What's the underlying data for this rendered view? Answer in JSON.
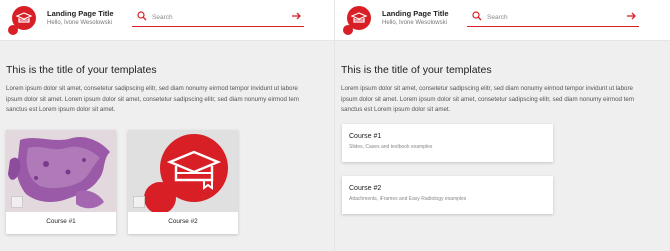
{
  "colors": {
    "accent": "#d81f26"
  },
  "header": {
    "title": "Landing Page Title",
    "subtitle": "Hello, Ivone Wesolowski",
    "search_placeholder": "Search",
    "logo_icon": "red-blob-graduation-cap-logo",
    "search_icon": "search-icon",
    "submit_icon": "arrow-right-icon"
  },
  "main": {
    "title": "This is the title of your templates",
    "intro_lines": [
      "Lorem ipsum dolor sit amet, consetetur sadipscing elitr, sed diam nonumy eirmod tempor invidunt ut labore",
      "ipsum dolor sit amet. Lorem ipsum dolor sit amet, consetetur sadipscing elitr, sed diam nonumy eirmod tem",
      "sanctus est Lorem ipsum dolor sit amet."
    ]
  },
  "tile_view": {
    "courses": [
      {
        "label": "Course #1",
        "image": "histology-slide"
      },
      {
        "label": "Course #2",
        "image": "graduation-cap-logo"
      }
    ]
  },
  "list_view": {
    "courses": [
      {
        "title": "Course #1",
        "subtitle": "Slides, Cases and textbook examples"
      },
      {
        "title": "Course #2",
        "subtitle": "Attachments, iFrames and Easy Radiology examples"
      }
    ]
  }
}
